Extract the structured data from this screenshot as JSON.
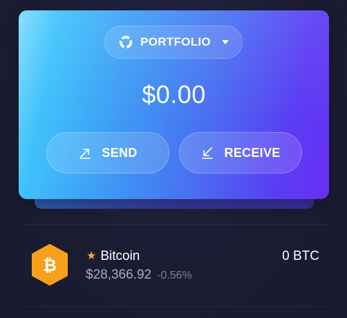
{
  "portfolio": {
    "selector_label": "PORTFOLIO",
    "selector_icon": "pie-chart-icon",
    "balance": "$0.00",
    "gradient_colors": [
      "#7fdcff",
      "#3fc2fb",
      "#4a6cf1",
      "#6a2ff6"
    ]
  },
  "actions": {
    "send_label": "SEND",
    "send_icon": "arrow-up-right-icon",
    "receive_label": "RECEIVE",
    "receive_icon": "arrow-down-left-icon"
  },
  "assets": [
    {
      "name": "Bitcoin",
      "favorite": true,
      "icon": "bitcoin-icon",
      "icon_color": "#f7a11a",
      "price": "$28,366.92",
      "change": "-0.56%",
      "balance": "0 BTC"
    }
  ],
  "colors": {
    "background": "#1c1d33",
    "favorite_star": "#f7a92a",
    "muted_text": "#a9acbf"
  }
}
